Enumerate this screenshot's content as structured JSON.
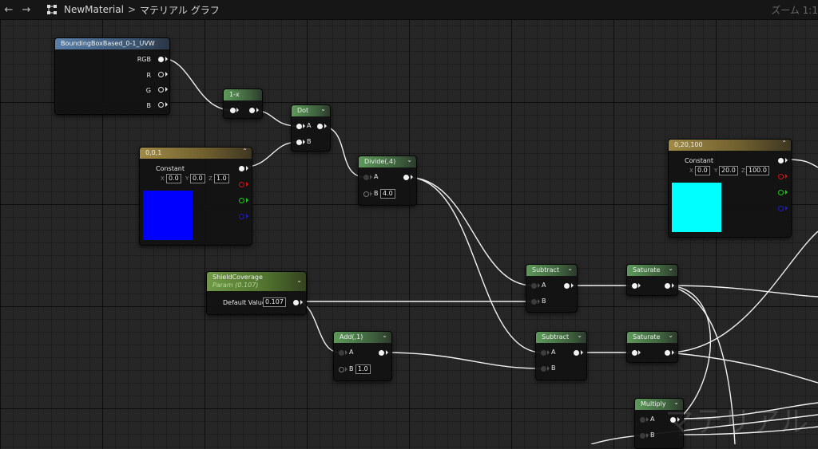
{
  "toolbar": {
    "back_icon": "←",
    "forward_icon": "→",
    "graph_icon": "material-graph-icon",
    "breadcrumb_asset": "NewMaterial",
    "breadcrumb_separator": ">",
    "breadcrumb_graph": "マテリアル グラフ",
    "zoom_label": "ズーム 1:1"
  },
  "watermark": "マテリアル",
  "colors": {
    "constant_blue": "#0000ff",
    "constant_cyan": "#00ffff",
    "pin_red": "#d81010",
    "pin_green": "#12d012",
    "pin_blue": "#1c1cc8"
  },
  "nodes": {
    "bbox": {
      "title": "BoundingBoxBased_0-1_UVW",
      "out_rgb": "RGB",
      "out_r": "R",
      "out_g": "G",
      "out_b": "B"
    },
    "oneminus": {
      "title": "1-x"
    },
    "dot": {
      "title": "Dot",
      "in_a": "A",
      "in_b": "B"
    },
    "const001": {
      "title": "0,0,1",
      "label": "Constant",
      "x_label": "X",
      "x": "0.0",
      "y_label": "Y",
      "y": "0.0",
      "z_label": "Z",
      "z": "1.0"
    },
    "divide": {
      "title": "Divide(,4)",
      "in_a": "A",
      "in_b": "B",
      "b_value": "4.0"
    },
    "const020100": {
      "title": "0,20,100",
      "label": "Constant",
      "x_label": "X",
      "x": "0.0",
      "y_label": "Y",
      "y": "20.0",
      "z_label": "Z",
      "z": "100.0"
    },
    "shield": {
      "title": "ShieldCoverage",
      "subtitle": "Param (0.107)",
      "default_label": "Default Value",
      "default_value": "0.107"
    },
    "subtract1": {
      "title": "Subtract",
      "in_a": "A",
      "in_b": "B"
    },
    "saturate1": {
      "title": "Saturate"
    },
    "add": {
      "title": "Add(,1)",
      "in_a": "A",
      "in_b": "B",
      "b_value": "1.0"
    },
    "subtract2": {
      "title": "Subtract",
      "in_a": "A",
      "in_b": "B"
    },
    "saturate2": {
      "title": "Saturate"
    },
    "multiply": {
      "title": "Multiply",
      "in_a": "A",
      "in_b": "B"
    }
  }
}
